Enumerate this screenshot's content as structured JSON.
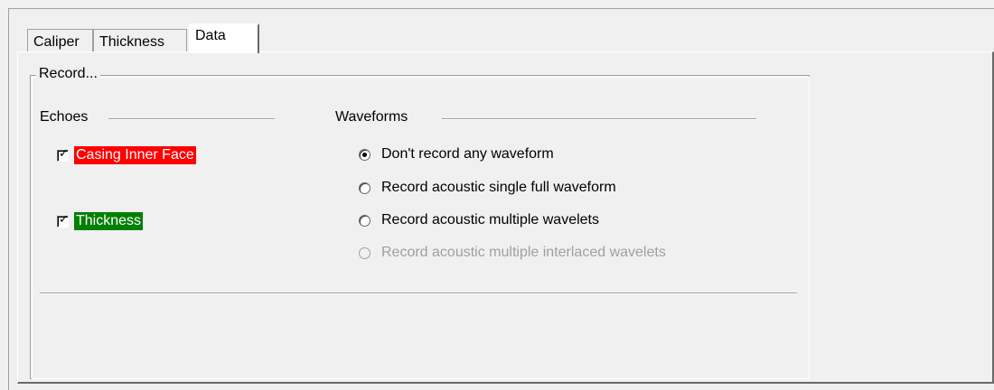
{
  "tabs": [
    {
      "label": "Caliper",
      "active": false
    },
    {
      "label": "Thickness",
      "active": false
    },
    {
      "label": "Data",
      "active": true
    }
  ],
  "record_group": {
    "title": "Record...",
    "echoes": {
      "heading": "Echoes",
      "items": [
        {
          "label": "Casing Inner Face",
          "checked": true,
          "color": "#ff0000"
        },
        {
          "label": "Thickness",
          "checked": true,
          "color": "#008000"
        }
      ]
    },
    "waveforms": {
      "heading": "Waveforms",
      "options": [
        {
          "label": "Don't record any waveform",
          "selected": true,
          "enabled": true
        },
        {
          "label": "Record acoustic single full waveform",
          "selected": false,
          "enabled": true
        },
        {
          "label": "Record acoustic multiple wavelets",
          "selected": false,
          "enabled": true
        },
        {
          "label": "Record acoustic multiple interlaced wavelets",
          "selected": false,
          "enabled": false
        }
      ]
    }
  },
  "colors": {
    "window_bg": "#f0f0f0",
    "disabled_text": "#a0a0a0"
  }
}
